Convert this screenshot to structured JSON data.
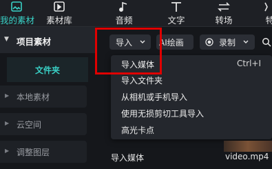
{
  "tabs": [
    {
      "label": "我的素材",
      "icon": "my-media-icon",
      "active": true
    },
    {
      "label": "素材库",
      "icon": "media-library-icon"
    },
    {
      "label": "音频",
      "icon": "music-note-icon"
    },
    {
      "label": "文字",
      "icon": "text-t-icon"
    },
    {
      "label": "转场",
      "icon": "transition-icon"
    },
    {
      "label": "特",
      "icon": "effects-icon"
    }
  ],
  "sidebar": {
    "section_title": "项目素材",
    "folder": "文件夹",
    "items": [
      "本地素材",
      "云空间",
      "调整图层"
    ]
  },
  "toolbar": {
    "import_label": "导入",
    "pip_label": "AI绘画",
    "record_label": "录制"
  },
  "import_menu": {
    "items": [
      {
        "label": "导入媒体",
        "shortcut": "Ctrl+I"
      },
      {
        "label": "导入文件夹",
        "shortcut": ""
      },
      {
        "label": "从相机或手机导入",
        "shortcut": ""
      },
      {
        "label": "使用无损剪切工具导入",
        "shortcut": ""
      },
      {
        "label": "高光卡点",
        "shortcut": ""
      }
    ]
  },
  "media": {
    "left_label": "导入媒体",
    "right_label": "video.mp4"
  },
  "colors": {
    "accent": "#39d1c6",
    "highlight": "#e00000"
  }
}
